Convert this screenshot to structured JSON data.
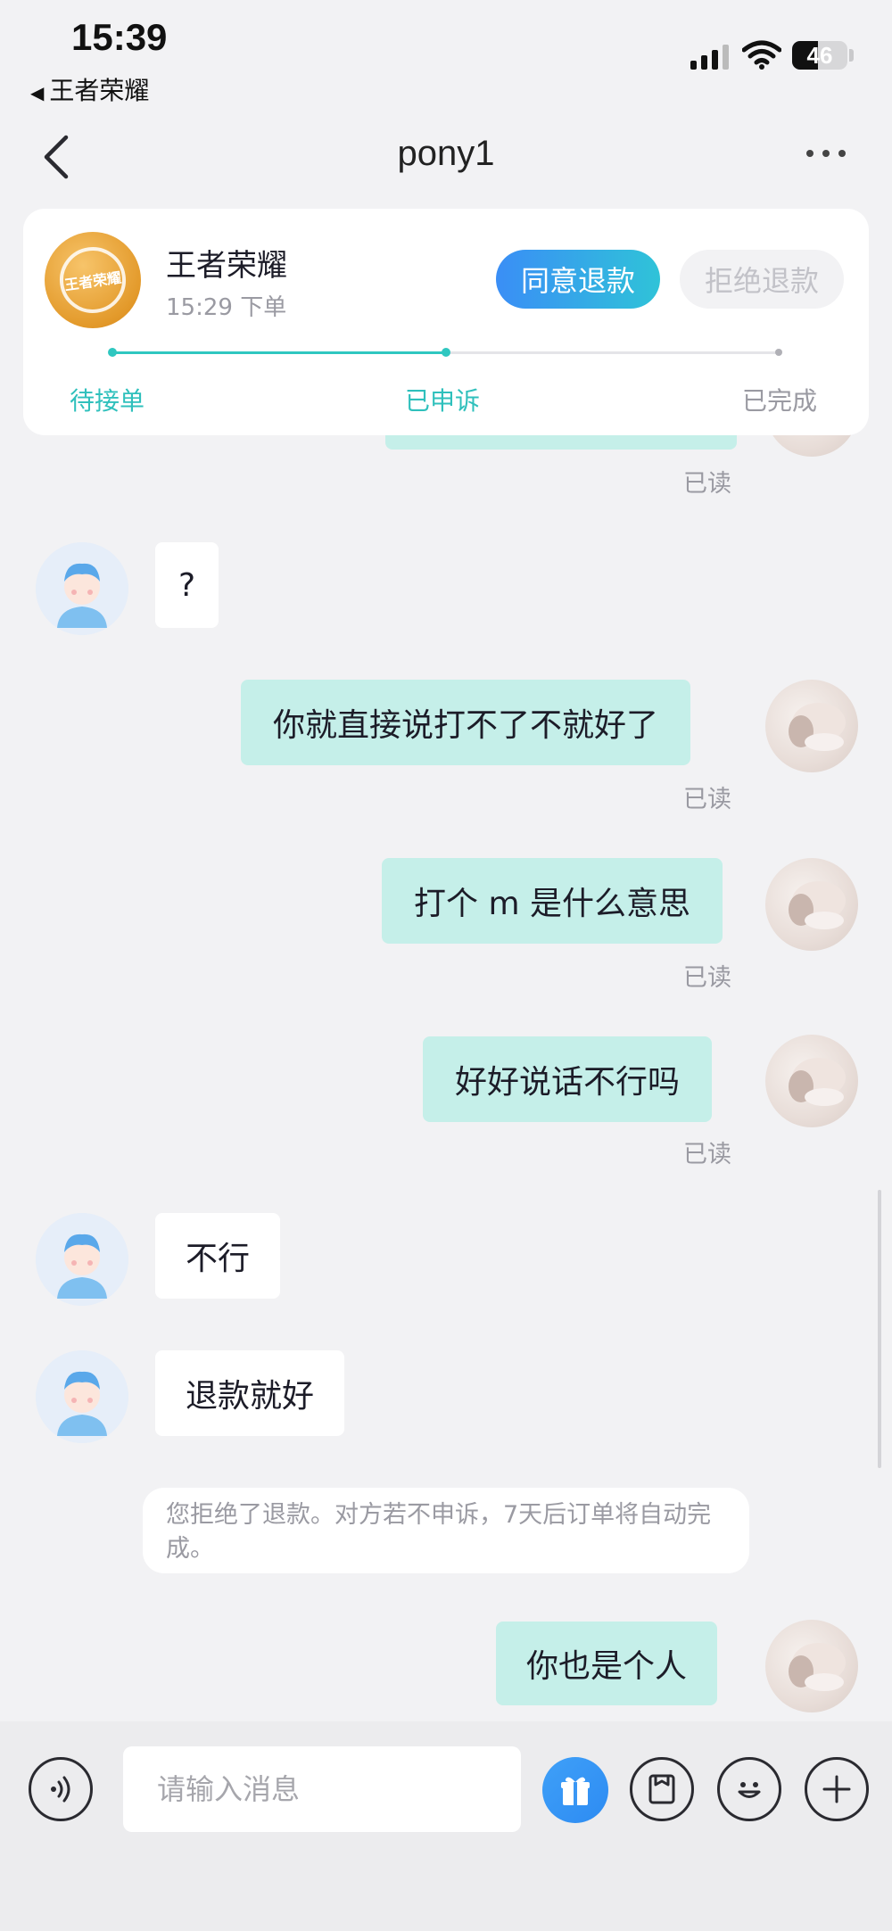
{
  "status_bar": {
    "time": "15:39",
    "back_app_label": "王者荣耀",
    "battery_percent": 46,
    "battery_text": "46"
  },
  "nav": {
    "title": "pony1"
  },
  "order_card": {
    "game_name": "王者荣耀",
    "order_time": "15:29 下单",
    "logo_text": "王者荣耀",
    "agree_label": "同意退款",
    "refuse_label": "拒绝退款",
    "progress_fraction": 0.5,
    "steps": [
      "待接单",
      "已申诉",
      "已完成"
    ]
  },
  "messages": {
    "read_label": "已读",
    "m1": "?",
    "m2": "你就直接说打不了不就好了",
    "m3": "打个 m 是什么意思",
    "m4": "好好说话不行吗",
    "m5": "不行",
    "m6": "退款就好",
    "system_notice": "您拒绝了退款。对方若不申诉，7天后订单将自动完成。",
    "m7": "你也是个人"
  },
  "input_bar": {
    "placeholder": "请输入消息"
  },
  "colors": {
    "accent": "#2fc0bc",
    "my_bubble": "#c5efe9",
    "button_gradient_start": "#3a8ef6",
    "button_gradient_end": "#2fc3d8"
  }
}
